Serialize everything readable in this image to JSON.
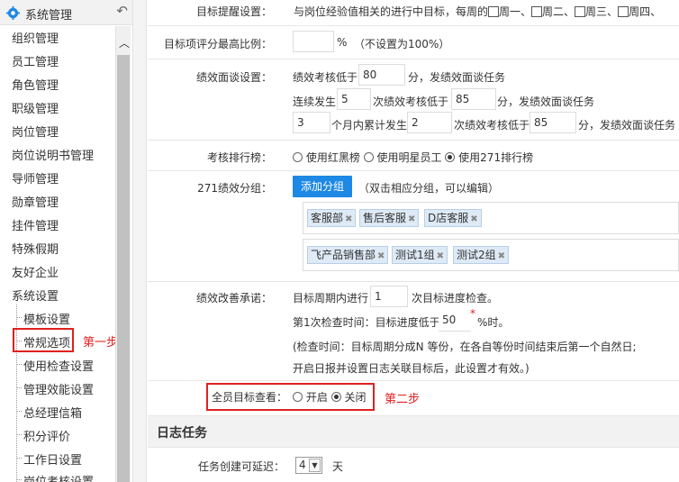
{
  "sidebar": {
    "title": "系统管理",
    "items": [
      "组织管理",
      "员工管理",
      "角色管理",
      "职级管理",
      "岗位管理",
      "岗位说明书管理",
      "导师管理",
      "勋章管理",
      "挂件管理",
      "特殊假期",
      "友好企业",
      "系统设置"
    ],
    "subitems": [
      "模板设置",
      "常规选项",
      "使用检查设置",
      "管理效能设置",
      "总经理信箱",
      "积分评价",
      "工作日设置",
      "岗位考核设置"
    ],
    "step1_note": "第一步"
  },
  "rows": {
    "goal_remind": {
      "label": "目标提醒设置：",
      "text": "与岗位经验值相关的进行中目标，每周的",
      "days": [
        "周一、",
        "周二、",
        "周三、",
        "周四、"
      ]
    },
    "goal_score": {
      "label": "目标项评分最高比例：",
      "value": "",
      "unit": "%",
      "hint": "（不设置为100%）"
    },
    "perf_talk": {
      "label": "绩效面谈设置：",
      "line1_pre": "绩效考核低于",
      "line1_val": "80",
      "line1_post": "分，发绩效面谈任务",
      "line2_pre": "连续发生",
      "line2_val1": "5",
      "line2_mid": "次绩效考核低于",
      "line2_val2": "85",
      "line2_post": "分，发绩效面谈任务",
      "line3_val1": "3",
      "line3_mid1": "个月内累计发生",
      "line3_val2": "2",
      "line3_mid2": "次绩效考核低于",
      "line3_val3": "85",
      "line3_post": "分，发绩效面谈任务"
    },
    "ranking": {
      "label": "考核排行榜：",
      "options": [
        "使用红黑榜",
        "使用明星员工",
        "使用271排行榜"
      ],
      "selected_index": 2
    },
    "groups271": {
      "label": "271绩效分组：",
      "add_button": "添加分组",
      "hint": "（双击相应分组，可以编辑）",
      "group1": [
        "客服部",
        "售后客服",
        "D店客服"
      ],
      "group2": [
        "飞产品销售部",
        "测试1组",
        "测试2组"
      ]
    },
    "improve": {
      "label": "绩效改善承诺：",
      "line1_pre": "目标周期内进行",
      "line1_val": "1",
      "line1_post": "次目标进度检查。",
      "line2_pre": "第1次检查时间：目标进度低于",
      "line2_val": "50",
      "line2_star": "*",
      "line2_post": "%时。",
      "line3": "(检查时间：目标周期分成N 等份，在各自等份时间结束后第一个自然日;",
      "line4": "开启日报并设置日志关联目标后，此设置才有效。)"
    },
    "all_view": {
      "label": "全员目标查看：",
      "options": [
        "开启",
        "关闭"
      ],
      "selected_index": 1,
      "step2_note": "第二步"
    }
  },
  "daily": {
    "section_title": "日志任务",
    "delay_label": "任务创建可延迟：",
    "delay_value": "4",
    "delay_unit": "天"
  }
}
